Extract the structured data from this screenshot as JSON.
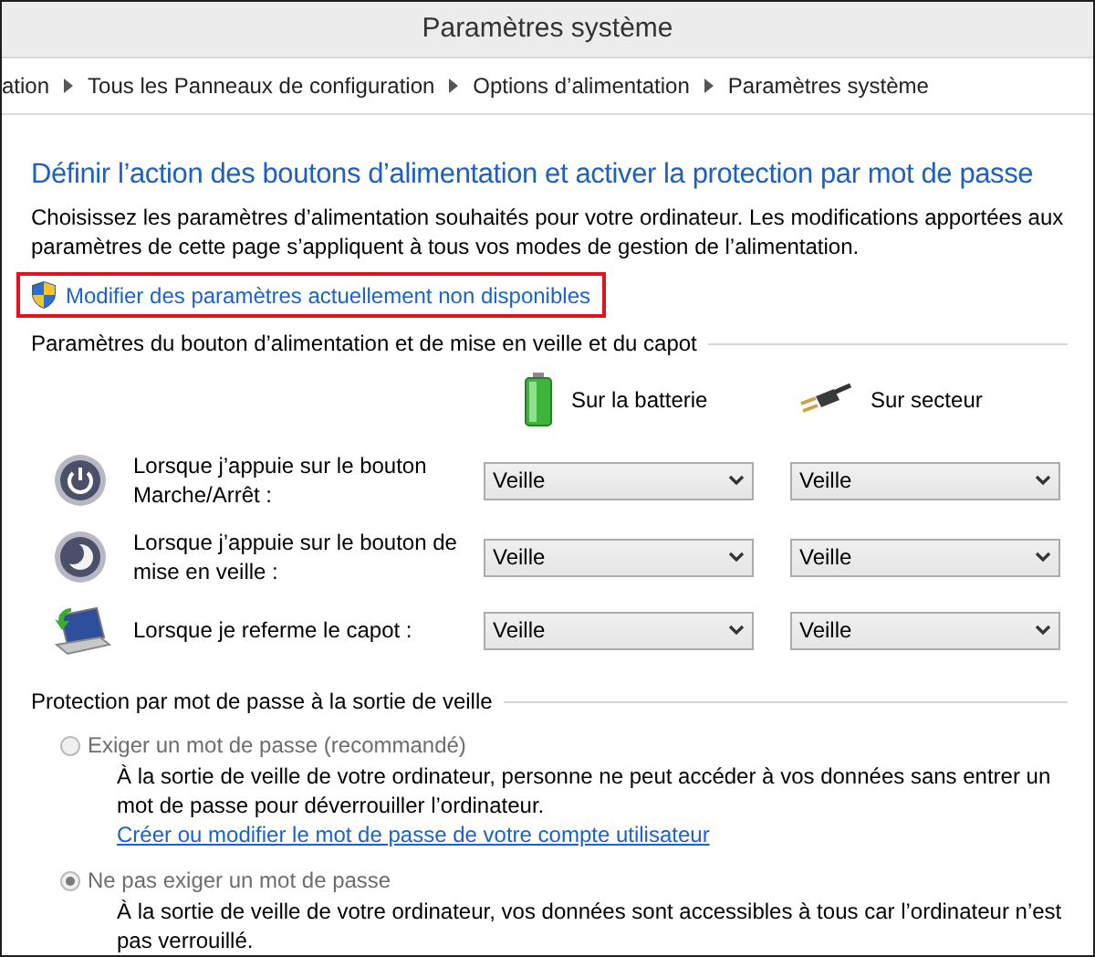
{
  "window": {
    "title": "Paramètres système"
  },
  "breadcrumb": [
    "ation",
    "Tous les Panneaux de configuration",
    "Options d’alimentation",
    "Paramètres système"
  ],
  "heading": "Définir l’action des boutons d’alimentation et activer la protection par mot de passe",
  "description": "Choisissez les paramètres d’alimentation souhaités pour votre ordinateur. Les modifications apportées aux paramètres de cette page s’appliquent à tous vos modes de gestion de l’alimentation.",
  "admin_link": {
    "text": "Modifier des paramètres actuellement non disponibles",
    "highlighted": true
  },
  "buttons_section": {
    "title": "Paramètres du bouton d’alimentation et de mise en veille et du capot",
    "columns": [
      {
        "kind": "battery",
        "label": "Sur la batterie"
      },
      {
        "kind": "plug",
        "label": "Sur secteur"
      }
    ],
    "rows": [
      {
        "kind": "power",
        "label": "Lorsque j’appuie sur le bouton Marche/Arrêt :",
        "values": [
          "Veille",
          "Veille"
        ]
      },
      {
        "kind": "sleep",
        "label": "Lorsque j’appuie sur le bouton de mise en veille :",
        "values": [
          "Veille",
          "Veille"
        ]
      },
      {
        "kind": "lid",
        "label": "Lorsque je referme le capot :",
        "values": [
          "Veille",
          "Veille"
        ]
      }
    ]
  },
  "password_section": {
    "title": "Protection par mot de passe à la sortie de veille",
    "options": [
      {
        "label": "Exiger un mot de passe (recommandé)",
        "selected": false,
        "disabled": true,
        "description": "À la sortie de veille de votre ordinateur, personne ne peut accéder à vos données sans entrer un mot de passe pour déverrouiller l’ordinateur.",
        "link": "Créer ou modifier le mot de passe de votre compte utilisateur"
      },
      {
        "label": "Ne pas exiger un mot de passe",
        "selected": true,
        "disabled": true,
        "description": "À la sortie de veille de votre ordinateur, vos données sont accessibles à tous car l’ordinateur n’est pas verrouillé."
      }
    ]
  }
}
